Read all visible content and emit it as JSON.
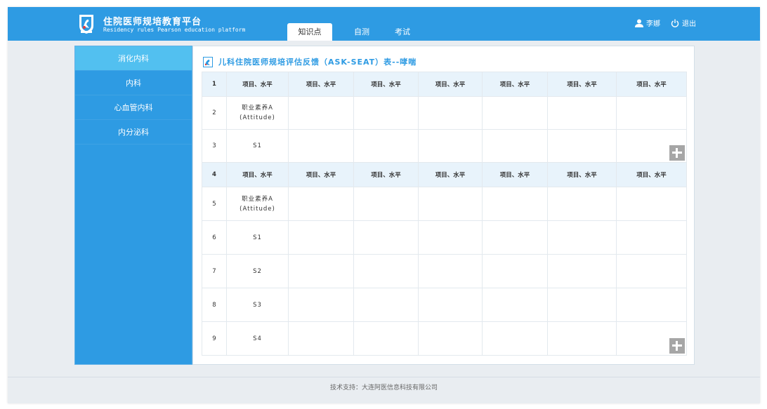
{
  "header": {
    "title": "住院医师规培教育平台",
    "subtitle": "Residency rules Pearson education platform",
    "tabs": [
      {
        "label": "知识点",
        "active": true
      },
      {
        "label": "自测",
        "active": false
      },
      {
        "label": "考试",
        "active": false
      }
    ],
    "user_name": "李娜",
    "logout_label": "退出"
  },
  "sidebar": {
    "items": [
      {
        "label": "消化内科",
        "active": true
      },
      {
        "label": "内科",
        "active": false
      },
      {
        "label": "心血管内科",
        "active": false
      },
      {
        "label": "内分泌科",
        "active": false
      }
    ]
  },
  "main": {
    "title": "儿科住院医师规培评估反馈（ASK-SEAT）表--哮喘",
    "header_cell": "项目、水平",
    "rows": [
      {
        "num": "1",
        "type": "header"
      },
      {
        "num": "2",
        "type": "data",
        "label_line1": "职业素养A",
        "label_line2": "(Attitude)"
      },
      {
        "num": "3",
        "type": "data",
        "label": "S1"
      },
      {
        "num": "4",
        "type": "header"
      },
      {
        "num": "5",
        "type": "data",
        "label_line1": "职业素养A",
        "label_line2": "(Attitude)"
      },
      {
        "num": "6",
        "type": "data",
        "label": "S1"
      },
      {
        "num": "7",
        "type": "data",
        "label": "S2"
      },
      {
        "num": "8",
        "type": "data",
        "label": "S3"
      },
      {
        "num": "9",
        "type": "data",
        "label": "S4"
      }
    ]
  },
  "footer": {
    "text": "技术支持：大连阿医信息科技有限公司"
  },
  "colors": {
    "primary": "#2e9be3",
    "sidebar_active": "#52c0f0",
    "table_header_bg": "#e8f3fb",
    "add_button": "#a6a6a6"
  },
  "icons": [
    "logo-icon",
    "user-icon",
    "power-icon",
    "title-icon",
    "plus-icon"
  ]
}
